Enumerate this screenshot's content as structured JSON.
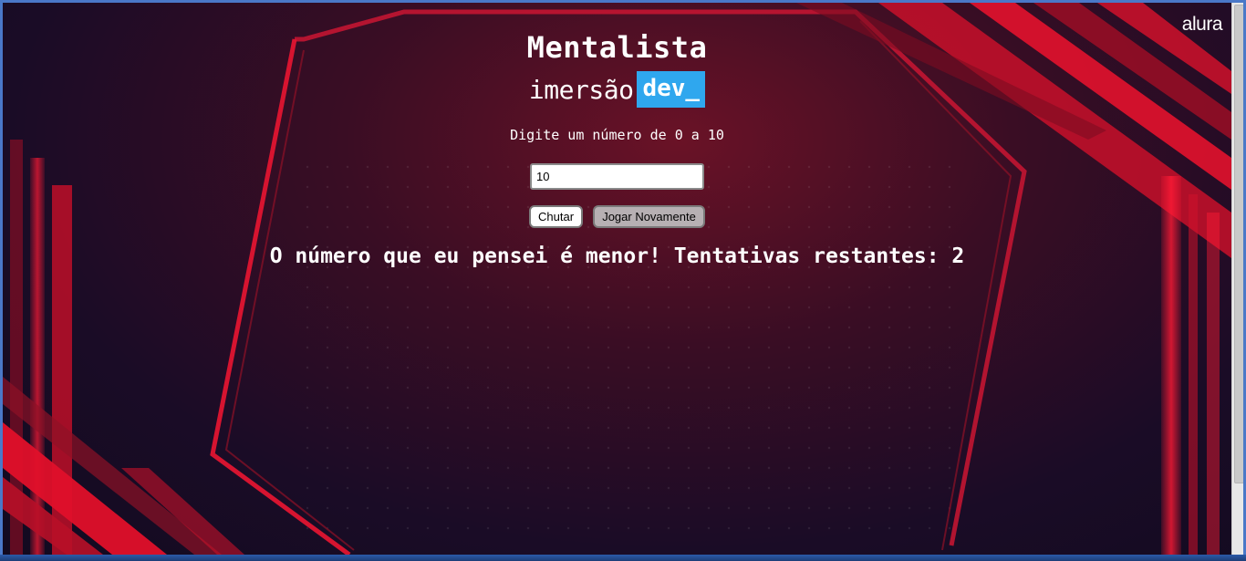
{
  "brand": {
    "logo_text": "alura"
  },
  "header": {
    "title": "Mentalista",
    "subtitle_word": "imersão",
    "subtitle_badge": "dev_"
  },
  "game": {
    "instruction": "Digite um número de 0 a 10",
    "input_value": "10",
    "kick_button_label": "Chutar",
    "reset_button_label": "Jogar Novamente",
    "result_message": "O número que eu pensei é menor! Tentativas restantes: 2"
  },
  "colors": {
    "badge": "#2fa7ee",
    "background": "#1a0c26",
    "accent_red": "#e0102a"
  }
}
